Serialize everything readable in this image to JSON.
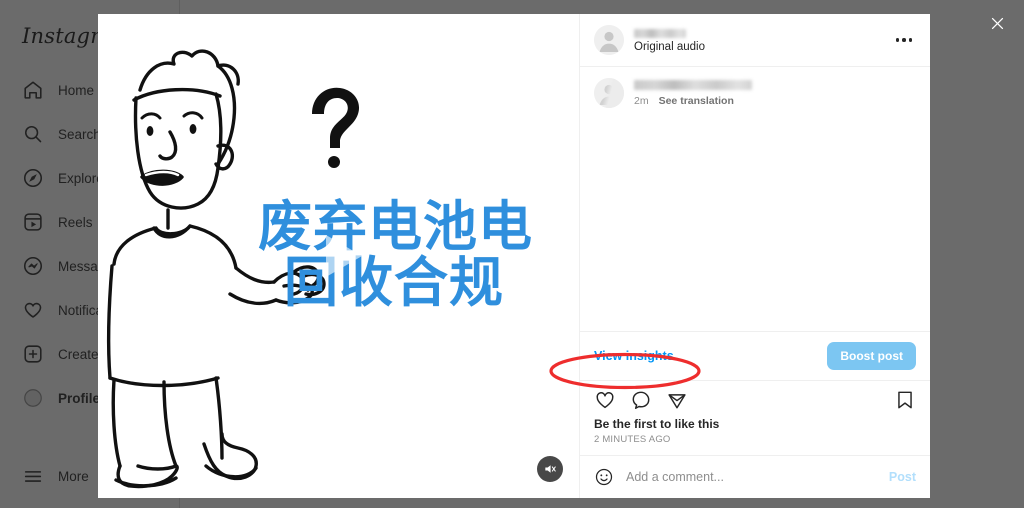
{
  "app": {
    "brand": "Instagram",
    "sidebar": {
      "items": [
        {
          "label": "Home",
          "icon": "home-icon"
        },
        {
          "label": "Search",
          "icon": "search-icon"
        },
        {
          "label": "Explore",
          "icon": "compass-icon"
        },
        {
          "label": "Reels",
          "icon": "reels-icon"
        },
        {
          "label": "Messages",
          "icon": "messenger-icon"
        },
        {
          "label": "Notifications",
          "icon": "heart-icon"
        },
        {
          "label": "Create",
          "icon": "plus-square-icon"
        },
        {
          "label": "Profile",
          "icon": "avatar-icon"
        }
      ],
      "more": {
        "label": "More",
        "icon": "hamburger-icon"
      }
    }
  },
  "overlay": {
    "close_label": "×"
  },
  "modal": {
    "media": {
      "caption_line1": "废弃电池电",
      "caption_line2": "回收合规",
      "caption_color": "#2f8fdd",
      "play_icon": "play-triangle-icon",
      "mute_icon": "speaker-muted-icon"
    },
    "header": {
      "username": "",
      "username_redacted": true,
      "audio_label": "Original audio",
      "menu_icon": "more-options-icon"
    },
    "caption_comment": {
      "text": "",
      "text_redacted": true,
      "timestamp": "2m",
      "translate_label": "See translation"
    },
    "insights": {
      "view_insights_label": "View insights",
      "view_insights_color": "#0095f6",
      "boost_label": "Boost post",
      "boost_color": "#7cc6f2"
    },
    "actions": {
      "like_icon": "heart-icon",
      "comment_icon": "comment-bubble-icon",
      "share_icon": "share-paperplane-icon",
      "save_icon": "bookmark-icon"
    },
    "likes": {
      "prefix": "Be the first to ",
      "emphasis": "like this",
      "full_text": "Be the first to like this",
      "time_ago": "2 MINUTES AGO"
    },
    "add_comment": {
      "emoji_icon": "emoji-smiley-icon",
      "placeholder": "Add a comment...",
      "post_label": "Post"
    }
  },
  "annotation": {
    "shape": "red-ellipse-highlight",
    "color": "#ee2d2d",
    "targets": "View insights"
  }
}
